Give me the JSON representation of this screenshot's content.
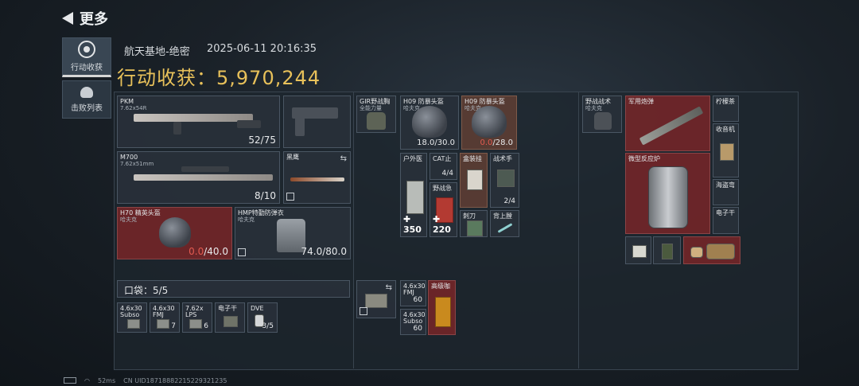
{
  "header": {
    "back_label": "更多"
  },
  "tabs": [
    {
      "label": "行动收获",
      "icon": "harvest-icon",
      "active": true
    },
    {
      "label": "击败列表",
      "icon": "skull-icon",
      "active": false
    }
  ],
  "match": {
    "map": "航天基地-绝密",
    "datetime": "2025-06-11 20:16:35",
    "harvest_label": "行动收获：",
    "harvest_value": "5,970,244"
  },
  "weapons": [
    {
      "name": "PKM",
      "caliber": "7.62x54R",
      "ammo": "52/75"
    },
    {
      "name": "M700",
      "caliber": "7.62x51mm",
      "ammo": "8/10"
    }
  ],
  "melee": {
    "name": "黑鹰"
  },
  "armor": [
    {
      "name": "H70 精英头盔",
      "maker": "哈夫克",
      "durability_current": "0.0",
      "durability_max": "/40.0"
    },
    {
      "name": "HMP特勤防弹衣",
      "maker": "哈夫克",
      "durability": "74.0/80.0"
    }
  ],
  "pocket": {
    "label": "口袋：5/5",
    "items": [
      {
        "name": "4.6x30",
        "sub": "Subso",
        "qty": ""
      },
      {
        "name": "4.6x30",
        "sub": "FMJ",
        "qty": "7"
      },
      {
        "name": "7.62x",
        "sub": "LPS",
        "qty": "6"
      },
      {
        "name": "电子干",
        "sub": "",
        "qty": ""
      },
      {
        "name": "DVE",
        "sub": "",
        "qty": "3/5"
      }
    ]
  },
  "chest": {
    "items": [
      {
        "name": "GIR野战胸",
        "sub": "全能力量"
      },
      {
        "name": "H09 防暴头盔",
        "sub": "哈夫克",
        "durability": "18.0/30.0"
      },
      {
        "name": "H09 防暴头盔",
        "sub": "哈夫克",
        "durability_current": "0.0",
        "durability_max": "/28.0"
      },
      {
        "name": "户外医",
        "heal": "350"
      },
      {
        "name": "CAT止",
        "qty": "4/4"
      },
      {
        "name": "野战急",
        "heal": "220"
      },
      {
        "name": "盒装挂"
      },
      {
        "name": "战术手",
        "qty": "2/4"
      },
      {
        "name": "刺刀"
      },
      {
        "name": "背上膛"
      }
    ]
  },
  "bag": {
    "items": [
      {
        "name": "4.6x30",
        "sub": "FMJ",
        "qty": "60"
      },
      {
        "name": "4.6x30",
        "sub": "Subso",
        "qty": "60"
      },
      {
        "name": "高级咖"
      }
    ]
  },
  "backpack": {
    "items": [
      {
        "name": "野战战术",
        "sub": "哈夫克"
      },
      {
        "name": "军用炮弹"
      },
      {
        "name": "柠檬茶"
      },
      {
        "name": "收音机"
      },
      {
        "name": "微型反应炉"
      },
      {
        "name": "海盗弯"
      },
      {
        "name": "电子干"
      }
    ]
  },
  "status": {
    "ping": "52ms",
    "uid": "CN UID18718882215229321235"
  }
}
